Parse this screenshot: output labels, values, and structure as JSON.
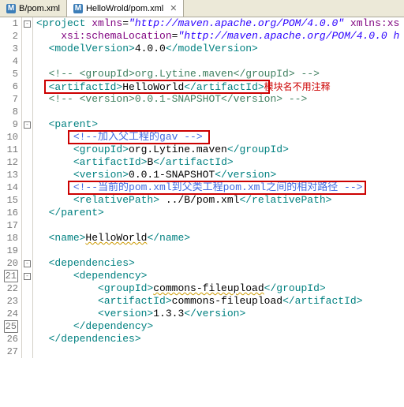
{
  "tabs": {
    "tab0": {
      "label": "B/pom.xml"
    },
    "tab1": {
      "label": "HelloWrold/pom.xml"
    }
  },
  "gutter": {
    "l1": "1",
    "l2": "2",
    "l3": "3",
    "l4": "4",
    "l5": "5",
    "l6": "6",
    "l7": "7",
    "l8": "8",
    "l9": "9",
    "l10": "10",
    "l11": "11",
    "l12": "12",
    "l13": "13",
    "l14": "14",
    "l15": "15",
    "l16": "16",
    "l17": "17",
    "l18": "18",
    "l19": "19",
    "l20": "20",
    "l21": "21",
    "l22": "22",
    "l23": "23",
    "l24": "24",
    "l25": "25",
    "l26": "26",
    "l27": "27"
  },
  "code": {
    "l1_open": "<project",
    "l1_attr1": " xmlns",
    "l1_eq": "=",
    "l1_val1": "\"http://maven.apache.org/POM/4.0.0\"",
    "l1_attr2": " xmlns:xs",
    "l2_attr": "xsi:schemaLocation",
    "l2_val": "\"http://maven.apache.org/POM/4.0.0 h",
    "l3_open": "<modelVersion>",
    "l3_text": "4.0.0",
    "l3_close": "</modelVersion>",
    "l5": "<!-- <groupId>org.Lytine.maven</groupId> -->",
    "l6_open": "<artifactId>",
    "l6_text": "HelloWorld",
    "l6_close": "</artifactId>",
    "l6_note": "模块名不用注释",
    "l7": "<!-- <version>0.0.1-SNAPSHOT</version> -->",
    "l9": "<parent>",
    "l10": "<!--加入父工程的gav -->",
    "l11_open": "<groupId>",
    "l11_text": "org.Lytine.maven",
    "l11_close": "</groupId>",
    "l12_open": "<artifactId>",
    "l12_text": "B",
    "l12_close": "</artifactId>",
    "l13_open": "<version>",
    "l13_text": "0.0.1-SNAPSHOT",
    "l13_close": "</version>",
    "l14": "<!--当前的pom.xml到父类工程pom.xml之间的相对路径 -->",
    "l15_open": "<relativePath>",
    "l15_text": " ../B/pom.xml",
    "l15_close": "</relativePath>",
    "l16": "</parent>",
    "l18_open": "<name>",
    "l18_text": "HelloWorld",
    "l18_close": "</name>",
    "l20": "<dependencies>",
    "l21": "<dependency>",
    "l22_open": "<groupId>",
    "l22_text": "commons-fileupload",
    "l22_close": "</groupId>",
    "l23_open": "<artifactId>",
    "l23_text": "commons-fileupload",
    "l23_close": "</artifactId>",
    "l24_open": "<version>",
    "l24_text": "1.3.3",
    "l24_close": "</version>",
    "l25": "</dependency>",
    "l26": "</dependencies>"
  }
}
